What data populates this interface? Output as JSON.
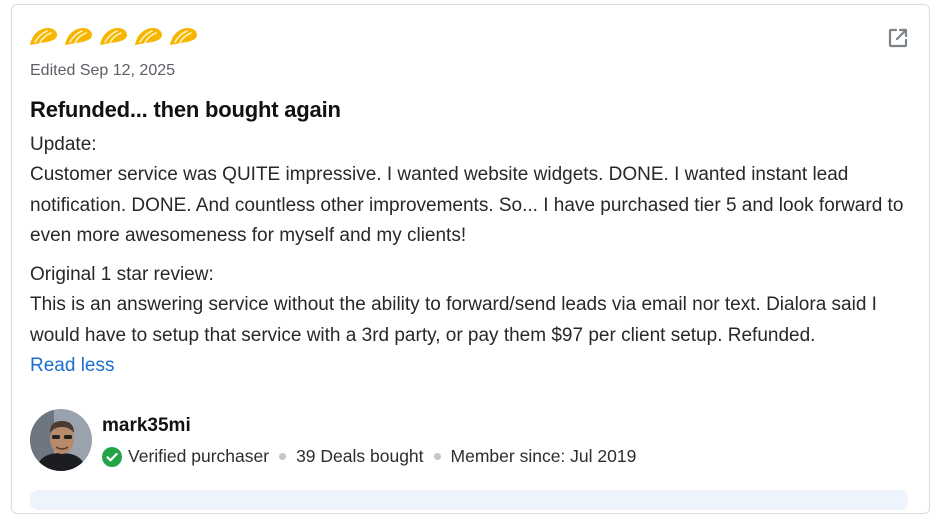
{
  "review": {
    "rating": 5,
    "rating_max": 5,
    "rating_icon": "taco-icon",
    "rating_color": "#f7b500",
    "date": "Edited Sep 12, 2025",
    "title": "Refunded... then bought again",
    "paragraphs": [
      "Update:",
      "Customer service was QUITE impressive. I wanted website widgets. DONE. I wanted instant lead notification. DONE. And countless other improvements. So... I have purchased tier 5 and look forward to even more awesomeness for myself and my clients!",
      "Original 1 star review:",
      "This is an answering service without the ability to forward/send leads via email nor text. Dialora said I would have to setup that service with a 3rd party, or pay them $97 per client setup. Refunded."
    ],
    "read_less_label": "Read less",
    "link_color": "#1a6fd2"
  },
  "reviewer": {
    "username": "mark35mi",
    "verified_label": "Verified purchaser",
    "verified_color": "#22a447",
    "deals_bought": "39 Deals bought",
    "member_since": "Member since: Jul 2019"
  },
  "icons": {
    "external_link": "external-link-icon",
    "verified": "check-circle-icon"
  }
}
